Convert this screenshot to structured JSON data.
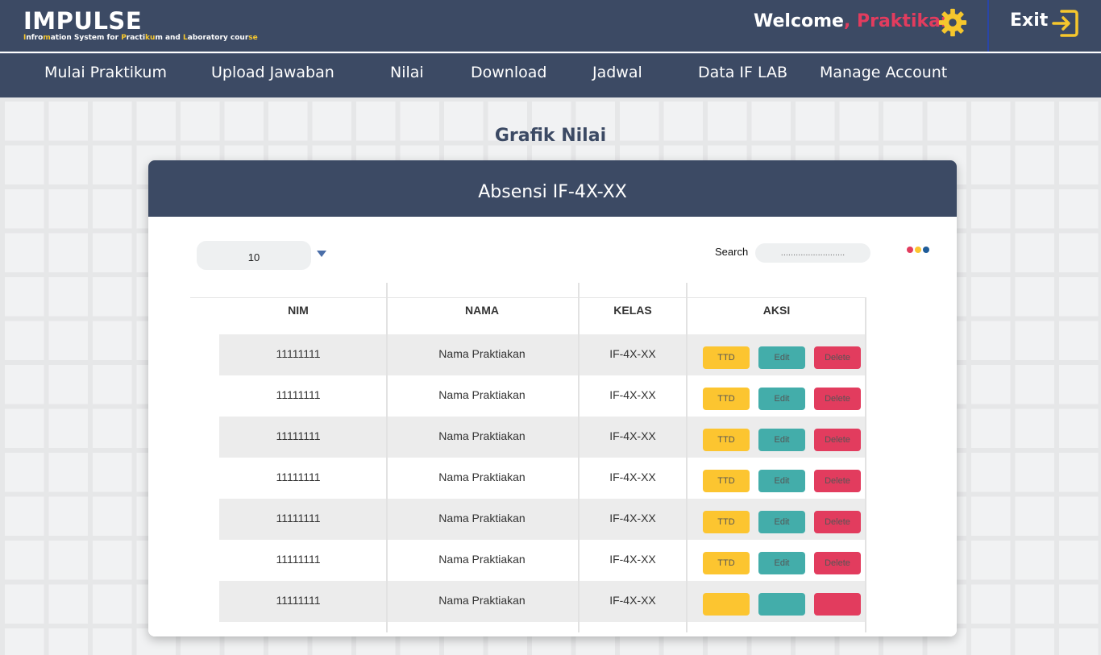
{
  "header": {
    "title": "IMPULSE",
    "subtitle_parts": [
      {
        "text": "I",
        "hl": true
      },
      {
        "text": "nfro",
        "hl": false
      },
      {
        "text": "m",
        "hl": true
      },
      {
        "text": "ation System for ",
        "hl": false
      },
      {
        "text": "P",
        "hl": true
      },
      {
        "text": "racti",
        "hl": false
      },
      {
        "text": "ku",
        "hl": true
      },
      {
        "text": "m and ",
        "hl": false
      },
      {
        "text": "L",
        "hl": true
      },
      {
        "text": "aboratory cour",
        "hl": false
      },
      {
        "text": "se",
        "hl": true
      }
    ],
    "welcome_prefix": "Welcome",
    "welcome_sep": ", ",
    "user_name": "Praktikan",
    "settings_icon": "gear-icon",
    "exit_label": "Exit",
    "exit_icon": "exit-icon"
  },
  "nav": [
    "Mulai Praktikum",
    "Upload Jawaban",
    "Nilai",
    "Download",
    "Jadwal",
    "Data IF LAB",
    "Manage Account"
  ],
  "page": {
    "title": "Grafik Nilai"
  },
  "card": {
    "title": "Absensi IF-4X-XX",
    "page_size": "10",
    "search_label": "Search",
    "search_placeholder": "..........................",
    "dot_colors": [
      "#e23c5e",
      "#fcc530",
      "#1f5c99"
    ]
  },
  "table": {
    "headers": [
      "NIM",
      "NAMA",
      "KELAS",
      "AKSI"
    ],
    "rows": [
      {
        "nim": "11111111",
        "nama": "Nama Praktiakan",
        "kelas": "IF-4X-XX"
      },
      {
        "nim": "11111111",
        "nama": "Nama Praktiakan",
        "kelas": "IF-4X-XX"
      },
      {
        "nim": "11111111",
        "nama": "Nama Praktiakan",
        "kelas": "IF-4X-XX"
      },
      {
        "nim": "11111111",
        "nama": "Nama Praktiakan",
        "kelas": "IF-4X-XX"
      },
      {
        "nim": "11111111",
        "nama": "Nama Praktiakan",
        "kelas": "IF-4X-XX"
      },
      {
        "nim": "11111111",
        "nama": "Nama Praktiakan",
        "kelas": "IF-4X-XX"
      },
      {
        "nim": "11111111",
        "nama": "Nama Praktiakan",
        "kelas": "IF-4X-XX"
      }
    ],
    "actions": {
      "ttd": "TTD",
      "edit": "Edit",
      "delete": "Delete"
    }
  },
  "colors": {
    "primary": "#3c4a64",
    "accent_red": "#e23c5e",
    "accent_yellow": "#fcc530",
    "accent_teal": "#43adaa"
  }
}
